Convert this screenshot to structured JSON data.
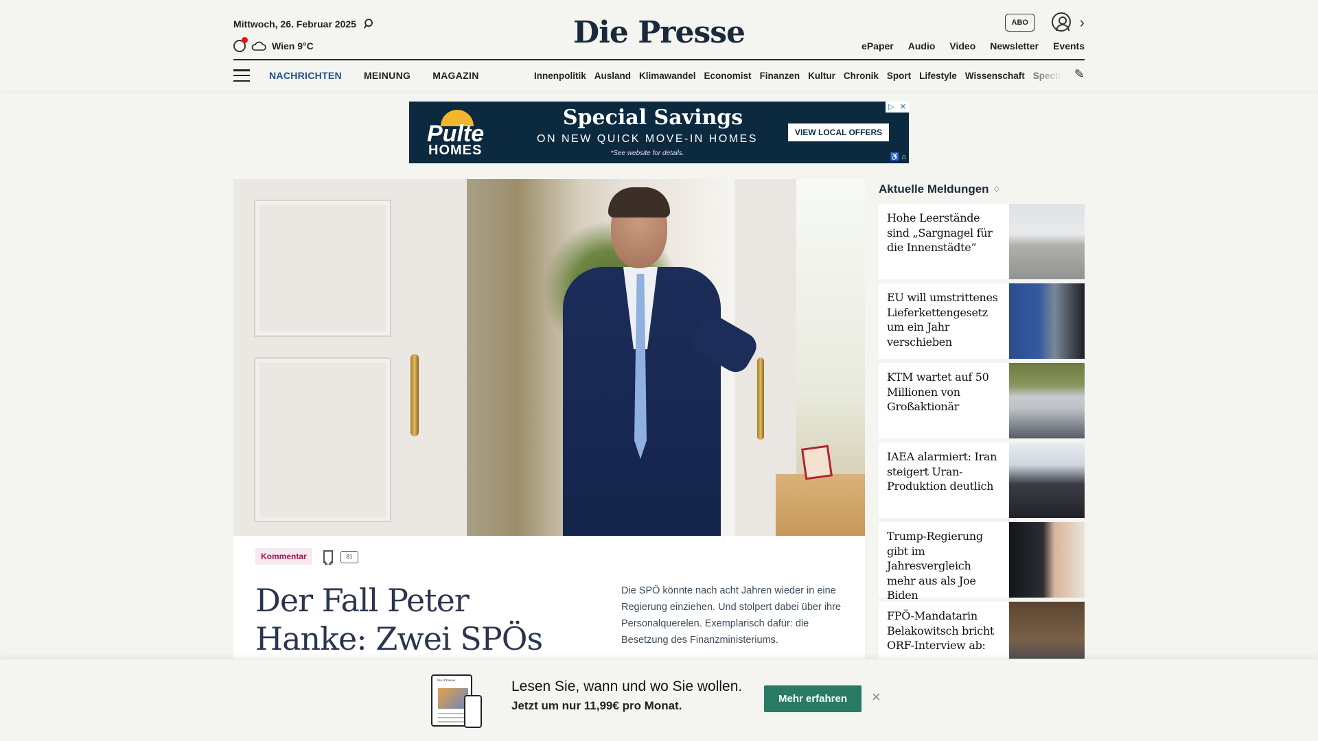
{
  "header": {
    "date": "Mittwoch, 26. Februar 2025",
    "weather": "Wien 9°C",
    "logo": "Die Presse",
    "abo_label": "ABO",
    "top_links": [
      "ePaper",
      "Audio",
      "Video",
      "Newsletter",
      "Events"
    ],
    "main_nav": [
      "NACHRICHTEN",
      "MEINUNG",
      "MAGAZIN"
    ],
    "sub_nav": [
      "Innenpolitik",
      "Ausland",
      "Klimawandel",
      "Economist",
      "Finanzen",
      "Kultur",
      "Chronik",
      "Sport",
      "Lifestyle",
      "Wissenschaft",
      "Spectrum"
    ]
  },
  "ad": {
    "brand_top": "Pulte",
    "brand_bottom": "HOMES",
    "headline": "Special Savings",
    "subline": "ON NEW QUICK MOVE-IN HOMES",
    "note": "*See website for details.",
    "cta": "VIEW LOCAL OFFERS"
  },
  "article": {
    "badge": "Kommentar",
    "comment_count": "81",
    "headline": "Der Fall Peter Hanke: Zwei SPÖs suchen",
    "teaser": "Die SPÖ könnte nach acht Jahren wieder in eine Regierung einziehen. Und stolpert dabei über ihre Personalquerelen. Exemplarisch dafür: die Besetzung des Finanzministeriums."
  },
  "sidebar": {
    "title": "Aktuelle Meldungen",
    "items": [
      {
        "title": "Hohe Leerstände sind „Sargnagel für die Innenstädte“"
      },
      {
        "title": "EU will umstrittenes Lieferkettengesetz um ein Jahr verschieben"
      },
      {
        "title": "KTM wartet auf 50 Millionen von Großaktionär"
      },
      {
        "title": "IAEA alarmiert: Iran steigert Uran-Produktion deutlich"
      },
      {
        "title": "Trump-Regierung gibt im Jahresvergleich mehr aus als Joe Biden"
      },
      {
        "title": "FPÖ-Mandatarin Belakowitsch bricht ORF-Interview ab:"
      }
    ]
  },
  "promo": {
    "title": "Lesen Sie, wann und wo Sie wollen.",
    "subtitle": "Jetzt um nur 11,99€ pro Monat.",
    "button": "Mehr erfahren",
    "close": "×"
  },
  "colors": {
    "accent_blue": "#1d4f8c",
    "badge_red": "#a1164d",
    "cta_green": "#2a7b63",
    "ad_navy": "#0c2a3f"
  }
}
